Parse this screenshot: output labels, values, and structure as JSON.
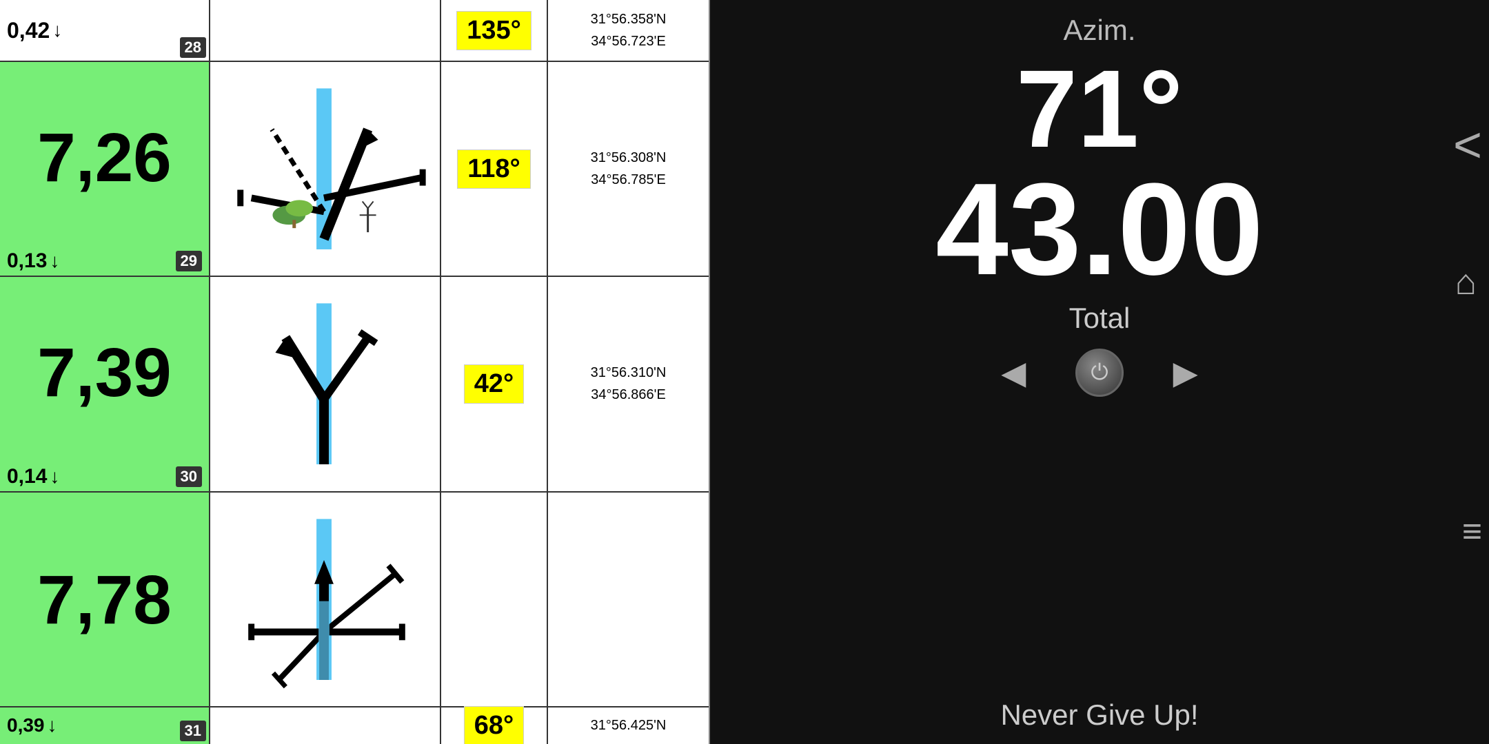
{
  "header": {
    "distance": "0,42",
    "row_num": "28",
    "bearing": "135°",
    "coords": "31°56.358'N\n34°56.723'E"
  },
  "rows": [
    {
      "big_number": "7,26",
      "sub_distance": "0,13",
      "sub_row_num": "29",
      "bearing": "118°",
      "coords": "31°56.308'N\n34°56.785'E",
      "diagram_type": "fork_right"
    },
    {
      "big_number": "7,39",
      "sub_distance": "0,14",
      "sub_row_num": "30",
      "bearing": "42°",
      "coords": "31°56.310'N\n34°56.866'E",
      "diagram_type": "fork_simple"
    },
    {
      "big_number": "7,78",
      "sub_distance": "0,39",
      "sub_row_num": "31",
      "bearing": "68°",
      "coords": "31°56.425'N",
      "diagram_type": "intersection"
    }
  ],
  "right_panel": {
    "azim_label": "Azim.",
    "azim_value": "71°",
    "distance_value": "43.00",
    "total_label": "Total",
    "never_give_up": "Never Give Up!",
    "arrow_left": "◄",
    "arrow_right": "►",
    "nav_back": "<",
    "home": "⌂",
    "menu": "≡"
  }
}
